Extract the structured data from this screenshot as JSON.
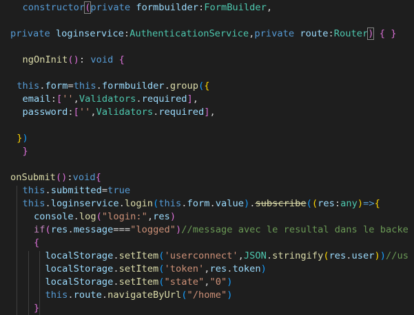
{
  "theme": {
    "background": "#1e1e1e",
    "colors": {
      "default": "#d4d4d4",
      "keyword": "#569cd6",
      "control": "#c586c0",
      "variable": "#9cdcfe",
      "type": "#4ec9b0",
      "function": "#dcdcaa",
      "string": "#ce9178",
      "comment": "#6a9955",
      "bracket1": "#ffd700",
      "bracket2": "#da70d6",
      "bracket3": "#179fff"
    }
  },
  "code_lines": [
    [
      {
        "t": "  ",
        "c": "default"
      },
      {
        "t": "constructor",
        "c": "keyword"
      },
      {
        "t": "(",
        "c": "matchbracket"
      },
      {
        "t": "private",
        "c": "keyword"
      },
      {
        "t": " ",
        "c": "default"
      },
      {
        "t": "formbuilder",
        "c": "variable"
      },
      {
        "t": ":",
        "c": "default"
      },
      {
        "t": "FormBuilder",
        "c": "type"
      },
      {
        "t": ",",
        "c": "default"
      }
    ],
    [],
    [
      {
        "t": "private",
        "c": "keyword"
      },
      {
        "t": " ",
        "c": "default"
      },
      {
        "t": "loginservice",
        "c": "variable"
      },
      {
        "t": ":",
        "c": "default"
      },
      {
        "t": "AuthenticationService",
        "c": "type"
      },
      {
        "t": ",",
        "c": "default"
      },
      {
        "t": "private",
        "c": "keyword"
      },
      {
        "t": " ",
        "c": "default"
      },
      {
        "t": "route",
        "c": "variable"
      },
      {
        "t": ":",
        "c": "default"
      },
      {
        "t": "Router",
        "c": "type"
      },
      {
        "t": ")",
        "c": "matchbracket"
      },
      {
        "t": " ",
        "c": "default"
      },
      {
        "t": "{",
        "c": "bracket2"
      },
      {
        "t": " ",
        "c": "default"
      },
      {
        "t": "}",
        "c": "bracket2"
      }
    ],
    [],
    [
      {
        "t": "  ",
        "c": "default"
      },
      {
        "t": "ngOnInit",
        "c": "function"
      },
      {
        "t": "()",
        "c": "bracket2"
      },
      {
        "t": ": ",
        "c": "default"
      },
      {
        "t": "void",
        "c": "keyword"
      },
      {
        "t": " ",
        "c": "default"
      },
      {
        "t": "{",
        "c": "bracket2"
      }
    ],
    [],
    [
      {
        "t": " ",
        "c": "default"
      },
      {
        "t": "this",
        "c": "keyword"
      },
      {
        "t": ".",
        "c": "default"
      },
      {
        "t": "form",
        "c": "variable"
      },
      {
        "t": "=",
        "c": "default"
      },
      {
        "t": "this",
        "c": "keyword"
      },
      {
        "t": ".",
        "c": "default"
      },
      {
        "t": "formbuilder",
        "c": "variable"
      },
      {
        "t": ".",
        "c": "default"
      },
      {
        "t": "group",
        "c": "function"
      },
      {
        "t": "(",
        "c": "bracket3"
      },
      {
        "t": "{",
        "c": "bracket1"
      }
    ],
    [
      {
        "t": "  ",
        "c": "default"
      },
      {
        "t": "email",
        "c": "variable"
      },
      {
        "t": ":",
        "c": "default"
      },
      {
        "t": "[",
        "c": "bracket2"
      },
      {
        "t": "''",
        "c": "string"
      },
      {
        "t": ",",
        "c": "default"
      },
      {
        "t": "Validators",
        "c": "type"
      },
      {
        "t": ".",
        "c": "default"
      },
      {
        "t": "required",
        "c": "variable"
      },
      {
        "t": "]",
        "c": "bracket2"
      },
      {
        "t": ",",
        "c": "default"
      }
    ],
    [
      {
        "t": "  ",
        "c": "default"
      },
      {
        "t": "password",
        "c": "variable"
      },
      {
        "t": ":",
        "c": "default"
      },
      {
        "t": "[",
        "c": "bracket2"
      },
      {
        "t": "''",
        "c": "string"
      },
      {
        "t": ",",
        "c": "default"
      },
      {
        "t": "Validators",
        "c": "type"
      },
      {
        "t": ".",
        "c": "default"
      },
      {
        "t": "required",
        "c": "variable"
      },
      {
        "t": "]",
        "c": "bracket2"
      },
      {
        "t": ",",
        "c": "default"
      }
    ],
    [],
    [
      {
        "t": " ",
        "c": "default"
      },
      {
        "t": "}",
        "c": "bracket1"
      },
      {
        "t": ")",
        "c": "bracket3"
      }
    ],
    [
      {
        "t": "  ",
        "c": "default"
      },
      {
        "t": "}",
        "c": "bracket2"
      }
    ],
    [],
    [
      {
        "t": "onSubmit",
        "c": "function"
      },
      {
        "t": "()",
        "c": "bracket2"
      },
      {
        "t": ":",
        "c": "default"
      },
      {
        "t": "void",
        "c": "keyword"
      },
      {
        "t": "{",
        "c": "bracket2"
      }
    ],
    [
      {
        "t": "  ",
        "c": "default"
      },
      {
        "t": "this",
        "c": "keyword"
      },
      {
        "t": ".",
        "c": "default"
      },
      {
        "t": "submitted",
        "c": "variable"
      },
      {
        "t": "=",
        "c": "default"
      },
      {
        "t": "true",
        "c": "keyword"
      }
    ],
    [
      {
        "t": "  ",
        "c": "default"
      },
      {
        "t": "this",
        "c": "keyword"
      },
      {
        "t": ".",
        "c": "default"
      },
      {
        "t": "loginservice",
        "c": "variable"
      },
      {
        "t": ".",
        "c": "default"
      },
      {
        "t": "login",
        "c": "function"
      },
      {
        "t": "(",
        "c": "bracket3"
      },
      {
        "t": "this",
        "c": "keyword"
      },
      {
        "t": ".",
        "c": "default"
      },
      {
        "t": "form",
        "c": "variable"
      },
      {
        "t": ".",
        "c": "default"
      },
      {
        "t": "value",
        "c": "variable"
      },
      {
        "t": ")",
        "c": "bracket3"
      },
      {
        "t": ".",
        "c": "default"
      },
      {
        "t": "subscribe",
        "c": "strike"
      },
      {
        "t": "(",
        "c": "bracket3"
      },
      {
        "t": "(",
        "c": "bracket1"
      },
      {
        "t": "res",
        "c": "variable"
      },
      {
        "t": ":",
        "c": "default"
      },
      {
        "t": "any",
        "c": "type"
      },
      {
        "t": ")",
        "c": "bracket1"
      },
      {
        "t": "=>",
        "c": "keyword"
      },
      {
        "t": "{",
        "c": "bracket1"
      }
    ],
    [
      {
        "t": "    ",
        "c": "default"
      },
      {
        "t": "console",
        "c": "variable"
      },
      {
        "t": ".",
        "c": "default"
      },
      {
        "t": "log",
        "c": "function"
      },
      {
        "t": "(",
        "c": "bracket2"
      },
      {
        "t": "\"login:\"",
        "c": "string"
      },
      {
        "t": ",",
        "c": "default"
      },
      {
        "t": "res",
        "c": "variable"
      },
      {
        "t": ")",
        "c": "bracket2"
      }
    ],
    [
      {
        "t": "    ",
        "c": "default"
      },
      {
        "t": "if",
        "c": "control"
      },
      {
        "t": "(",
        "c": "bracket2"
      },
      {
        "t": "res",
        "c": "variable"
      },
      {
        "t": ".",
        "c": "default"
      },
      {
        "t": "message",
        "c": "variable"
      },
      {
        "t": "===",
        "c": "default"
      },
      {
        "t": "\"logged\"",
        "c": "string"
      },
      {
        "t": ")",
        "c": "bracket2"
      },
      {
        "t": "//message avec le resultal dans le backe",
        "c": "comment"
      }
    ],
    [
      {
        "t": "    ",
        "c": "default"
      },
      {
        "t": "{",
        "c": "bracket2"
      }
    ],
    [
      {
        "t": "      ",
        "c": "default"
      },
      {
        "t": "localStorage",
        "c": "variable"
      },
      {
        "t": ".",
        "c": "default"
      },
      {
        "t": "setItem",
        "c": "function"
      },
      {
        "t": "(",
        "c": "bracket3"
      },
      {
        "t": "'userconnect'",
        "c": "string"
      },
      {
        "t": ",",
        "c": "default"
      },
      {
        "t": "JSON",
        "c": "type"
      },
      {
        "t": ".",
        "c": "default"
      },
      {
        "t": "stringify",
        "c": "function"
      },
      {
        "t": "(",
        "c": "bracket1"
      },
      {
        "t": "res",
        "c": "variable"
      },
      {
        "t": ".",
        "c": "default"
      },
      {
        "t": "user",
        "c": "variable"
      },
      {
        "t": ")",
        "c": "bracket1"
      },
      {
        "t": ")",
        "c": "bracket3"
      },
      {
        "t": "//us",
        "c": "comment"
      }
    ],
    [
      {
        "t": "      ",
        "c": "default"
      },
      {
        "t": "localStorage",
        "c": "variable"
      },
      {
        "t": ".",
        "c": "default"
      },
      {
        "t": "setItem",
        "c": "function"
      },
      {
        "t": "(",
        "c": "bracket3"
      },
      {
        "t": "'token'",
        "c": "string"
      },
      {
        "t": ",",
        "c": "default"
      },
      {
        "t": "res",
        "c": "variable"
      },
      {
        "t": ".",
        "c": "default"
      },
      {
        "t": "token",
        "c": "variable"
      },
      {
        "t": ")",
        "c": "bracket3"
      }
    ],
    [
      {
        "t": "      ",
        "c": "default"
      },
      {
        "t": "localStorage",
        "c": "variable"
      },
      {
        "t": ".",
        "c": "default"
      },
      {
        "t": "setItem",
        "c": "function"
      },
      {
        "t": "(",
        "c": "bracket3"
      },
      {
        "t": "\"state\"",
        "c": "string"
      },
      {
        "t": ",",
        "c": "default"
      },
      {
        "t": "\"0\"",
        "c": "string"
      },
      {
        "t": ")",
        "c": "bracket3"
      }
    ],
    [
      {
        "t": "      ",
        "c": "default"
      },
      {
        "t": "this",
        "c": "keyword"
      },
      {
        "t": ".",
        "c": "default"
      },
      {
        "t": "route",
        "c": "variable"
      },
      {
        "t": ".",
        "c": "default"
      },
      {
        "t": "navigateByUrl",
        "c": "function"
      },
      {
        "t": "(",
        "c": "bracket3"
      },
      {
        "t": "\"/home\"",
        "c": "string"
      },
      {
        "t": ")",
        "c": "bracket3"
      }
    ],
    [
      {
        "t": "    ",
        "c": "default"
      },
      {
        "t": "}",
        "c": "bracket2"
      }
    ]
  ]
}
